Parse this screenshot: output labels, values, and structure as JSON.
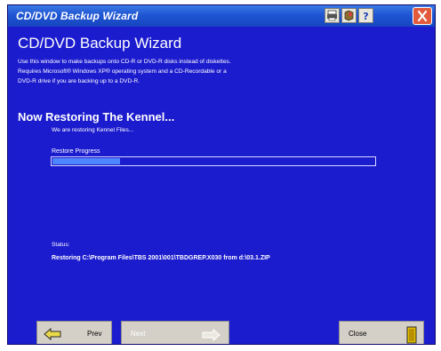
{
  "window": {
    "title": "CD/DVD Backup Wizard",
    "heading": "CD/DVD Backup Wizard",
    "description_lines": [
      "Use this window to make backups onto CD-R or DVD-R disks instead of diskettes.",
      "Requires Microsoft® Windows XP® operating system and a CD-Recordable or a",
      "DVD-R drive if you are backing up to a DVD-R."
    ]
  },
  "restore": {
    "heading": "Now Restoring The Kennel...",
    "message": "We are restoring Kennel Files...",
    "progress_label": "Restore Progress",
    "progress": 0.21
  },
  "status": {
    "label": "Status:",
    "text": "Restoring C:\\Program Files\\TBS 2001\\001\\TBDGREP.X030 from d:\\03.1.ZIP"
  },
  "buttons": {
    "prev": "Prev",
    "next": "Next",
    "close": "Close"
  },
  "icons": [
    "printer-icon",
    "help-icon",
    "question-icon",
    "close-icon",
    "back-arrow-icon",
    "forward-arrow-icon",
    "exit-door-icon"
  ],
  "colors": {
    "window_bg": "#1c1ccf",
    "titlebar": "#1f55d3",
    "progress_fill": "#4d86ff",
    "close_button": "#e25a3a"
  }
}
